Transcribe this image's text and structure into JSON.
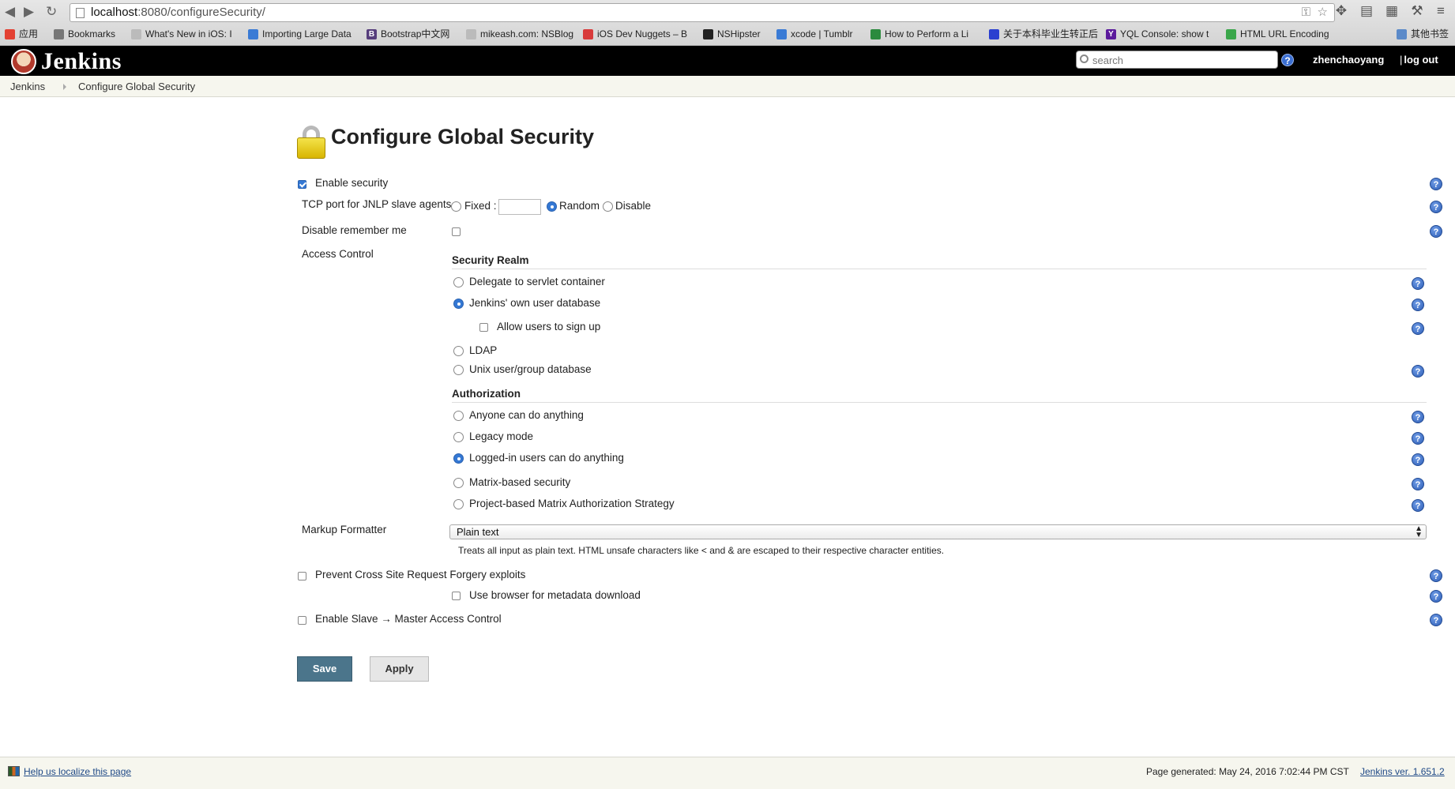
{
  "browser": {
    "url_host": "localhost",
    "url_path": ":8080/configureSecurity/",
    "bookmarks": [
      {
        "label": "应用",
        "icon": "apps-icon",
        "color": "#e34133"
      },
      {
        "label": "Bookmarks",
        "icon": "folder-icon",
        "color": "#777777"
      },
      {
        "label": "What's New in iOS: I",
        "icon": "page-icon",
        "color": "#999999"
      },
      {
        "label": "Importing Large Data",
        "icon": "arrow-icon",
        "color": "#3a7bd5"
      },
      {
        "label": "Bootstrap中文网",
        "icon": "bootstrap-icon",
        "color": "#563d7c"
      },
      {
        "label": "mikeash.com: NSBlog",
        "icon": "page-icon",
        "color": "#999999"
      },
      {
        "label": "iOS Dev Nuggets – B",
        "icon": "nuggets-icon",
        "color": "#d83a3a"
      },
      {
        "label": "NSHipster",
        "icon": "mustache-icon",
        "color": "#222222"
      },
      {
        "label": "xcode | Tumblr",
        "icon": "xcode-icon",
        "color": "#3a7bd5"
      },
      {
        "label": "How to Perform a Li",
        "icon": "feather-icon",
        "color": "#2b8a3e"
      },
      {
        "label": "关于本科毕业生转正后",
        "icon": "paw-icon",
        "color": "#2a3fd0"
      },
      {
        "label": "YQL Console: show t",
        "icon": "yahoo-icon",
        "color": "#5b1a9c"
      },
      {
        "label": "HTML URL Encoding",
        "icon": "chart-icon",
        "color": "#3aa64a"
      },
      {
        "label": "其他书签",
        "icon": "folder-icon",
        "color": "#5b8ac9"
      }
    ]
  },
  "header": {
    "logo_text": "Jenkins",
    "search_placeholder": "search",
    "help_glyph": "?",
    "username": "zhenchaoyang",
    "logout_sep": "|",
    "logout": "log out"
  },
  "breadcrumbs": [
    "Jenkins",
    "Configure Global Security"
  ],
  "page": {
    "title": "Configure Global Security",
    "enable_security": {
      "label": "Enable security",
      "checked": true
    },
    "tcp_port": {
      "label": "TCP port for JNLP slave agents",
      "options": [
        "Fixed :",
        "Random",
        "Disable"
      ],
      "selected": "Random",
      "fixed_value": ""
    },
    "disable_remember_me": {
      "label": "Disable remember me",
      "checked": false
    },
    "access_control_label": "Access Control",
    "security_realm": {
      "heading": "Security Realm",
      "options": [
        "Delegate to servlet container",
        "Jenkins' own user database",
        "LDAP",
        "Unix user/group database"
      ],
      "selected": "Jenkins' own user database",
      "allow_signup": {
        "label": "Allow users to sign up",
        "checked": false
      }
    },
    "authorization": {
      "heading": "Authorization",
      "options": [
        "Anyone can do anything",
        "Legacy mode",
        "Logged-in users can do anything",
        "Matrix-based security",
        "Project-based Matrix Authorization Strategy"
      ],
      "selected": "Logged-in users can do anything"
    },
    "markup_formatter": {
      "label": "Markup Formatter",
      "selected": "Plain text",
      "description": "Treats all input as plain text. HTML unsafe characters like < and & are escaped to their respective character entities."
    },
    "csrf": {
      "label": "Prevent Cross Site Request Forgery exploits",
      "checked": false
    },
    "browser_metadata": {
      "label": "Use browser for metadata download",
      "checked": false
    },
    "slave_master": {
      "label": "Enable Slave → Master Access Control",
      "checked": false
    },
    "save_label": "Save",
    "apply_label": "Apply"
  },
  "footer": {
    "localize_link": "Help us localize this page",
    "generated": "Page generated: May 24, 2016 7:02:44 PM CST",
    "version_link": "Jenkins ver. 1.651.2"
  },
  "colors": {
    "header_bg": "#000000",
    "accent_blue": "#3478d4",
    "save_button": "#4b758b",
    "breadcrumb_bg": "#f6f6ee"
  }
}
